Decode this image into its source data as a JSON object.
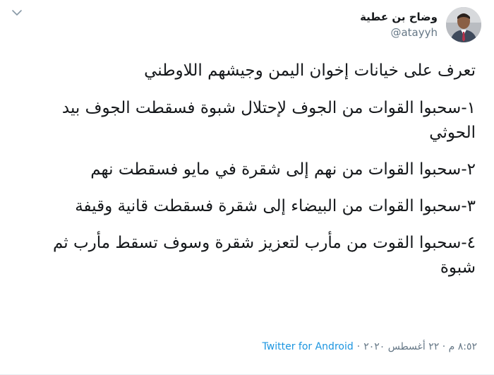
{
  "user": {
    "display_name": "وضاح بن عطية",
    "handle": "@atayyh"
  },
  "tweet": {
    "paragraphs": [
      "تعرف على خيانات إخوان اليمن وجيشهم اللاوطني",
      "١-سحبوا القوات من الجوف لإحتلال شبوة فسقطت الجوف بيد الحوثي",
      "٢-سحبوا القوات من نهم إلى شقرة في مايو فسقطت نهم",
      "٣-سحبوا القوات من البيضاء إلى شقرة فسقطت قانية وقيفة",
      "٤-سحبوا القوت من مأرب لتعزيز شقرة وسوف تسقط مأرب ثم شبوة"
    ]
  },
  "meta": {
    "datetime": "٨:٥٢ م · ٢٢ أغسطس ٢٠٢٠",
    "separator": "·",
    "source": "Twitter for Android"
  },
  "icons": {
    "more": "chevron-down-icon",
    "avatar": "avatar-photo"
  },
  "colors": {
    "text": "#14171a",
    "secondary": "#657786",
    "link": "#1b95e0"
  }
}
